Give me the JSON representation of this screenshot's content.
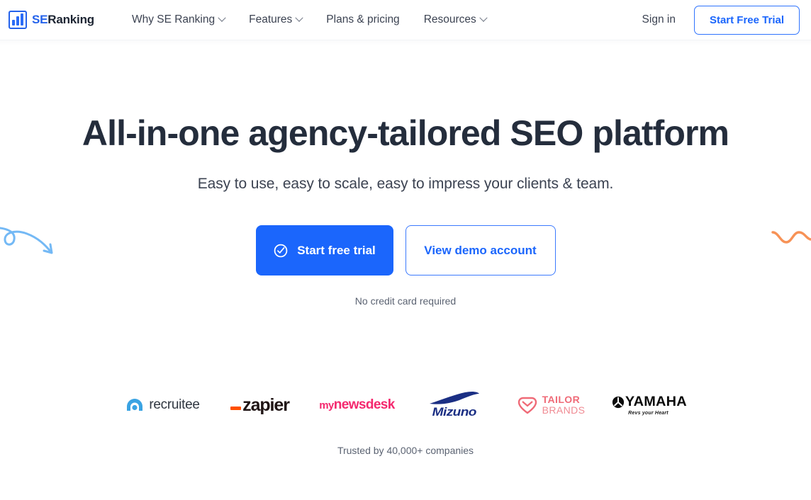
{
  "header": {
    "logo": {
      "icon": "bar-chart-icon",
      "text_primary": "SE",
      "text_secondary": "Ranking"
    },
    "nav": [
      {
        "label": "Why SE Ranking",
        "has_dropdown": true
      },
      {
        "label": "Features",
        "has_dropdown": true
      },
      {
        "label": "Plans & pricing",
        "has_dropdown": false
      },
      {
        "label": "Resources",
        "has_dropdown": true
      }
    ],
    "sign_in": "Sign in",
    "start_free_trial": "Start Free Trial"
  },
  "hero": {
    "title": "All-in-one agency-tailored SEO platform",
    "subtitle": "Easy to use, easy to scale, easy to impress your clients & team.",
    "primary_cta": "Start free trial",
    "primary_cta_icon": "check-circle-icon",
    "secondary_cta": "View demo account",
    "note": "No credit card required"
  },
  "clients": {
    "logos": [
      {
        "name": "recruitee",
        "label": "recruitee"
      },
      {
        "name": "zapier",
        "label": "zapier"
      },
      {
        "name": "mynewsdesk",
        "label_prefix": "my",
        "label": "newsdesk"
      },
      {
        "name": "mizuno",
        "label": "Mizuno"
      },
      {
        "name": "tailor-brands",
        "label_line1": "TAILOR",
        "label_line2": "BRANDS"
      },
      {
        "name": "yamaha",
        "label": "YAMAHA",
        "tagline": "Revs your Heart"
      }
    ],
    "trusted_text": "Trusted by 40,000+ companies"
  },
  "colors": {
    "brand_blue": "#1b66fc",
    "logo_blue": "#2563eb",
    "heading": "#242d3c",
    "body_text": "#3c4352",
    "muted_text": "#5b6372",
    "squiggle_blue": "#74b9f5",
    "squiggle_orange": "#f79256"
  }
}
